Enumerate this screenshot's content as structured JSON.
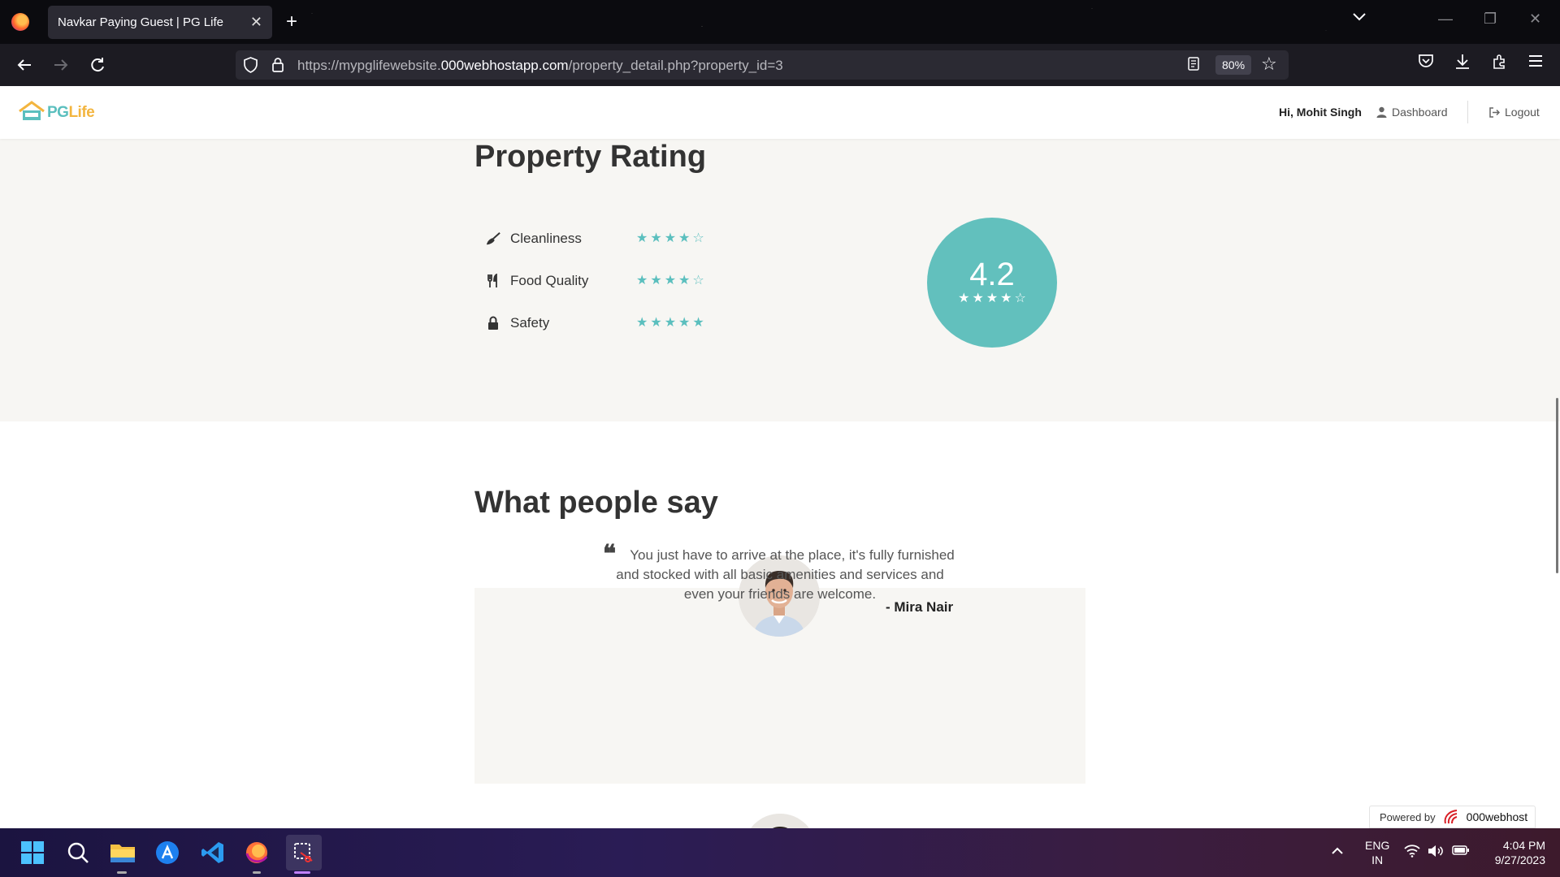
{
  "browser": {
    "tab_title": "Navkar Paying Guest | PG Life",
    "url_prefix": "https://mypglifewebsite.",
    "url_domain": "000webhostapp.com",
    "url_path": "/property_detail.php?property_id=3",
    "zoom": "80%"
  },
  "header": {
    "logo_pg": "PG",
    "logo_life": "Life",
    "greeting": "Hi, Mohit Singh",
    "dashboard_label": "Dashboard",
    "logout_label": "Logout"
  },
  "rating": {
    "title": "Property Rating",
    "items": [
      {
        "label": "Cleanliness",
        "icon": "broom-icon",
        "stars": 4
      },
      {
        "label": "Food Quality",
        "icon": "utensils-icon",
        "stars": 4
      },
      {
        "label": "Safety",
        "icon": "lock-icon",
        "stars": 5
      }
    ],
    "overall": "4.2",
    "overall_stars": 4,
    "accent": "#62c0bd"
  },
  "testimonials": {
    "title": "What people say",
    "items": [
      {
        "quote": "You just have to arrive at the place, it's fully furnished and stocked with all basic amenities and services and even your friends are welcome.",
        "author": "- Mira Nair"
      }
    ]
  },
  "footer_badge": {
    "powered_by": "Powered by",
    "brand": "000webhost"
  },
  "taskbar": {
    "language": "ENG",
    "region": "IN",
    "time": "4:04 PM",
    "date": "9/27/2023"
  }
}
